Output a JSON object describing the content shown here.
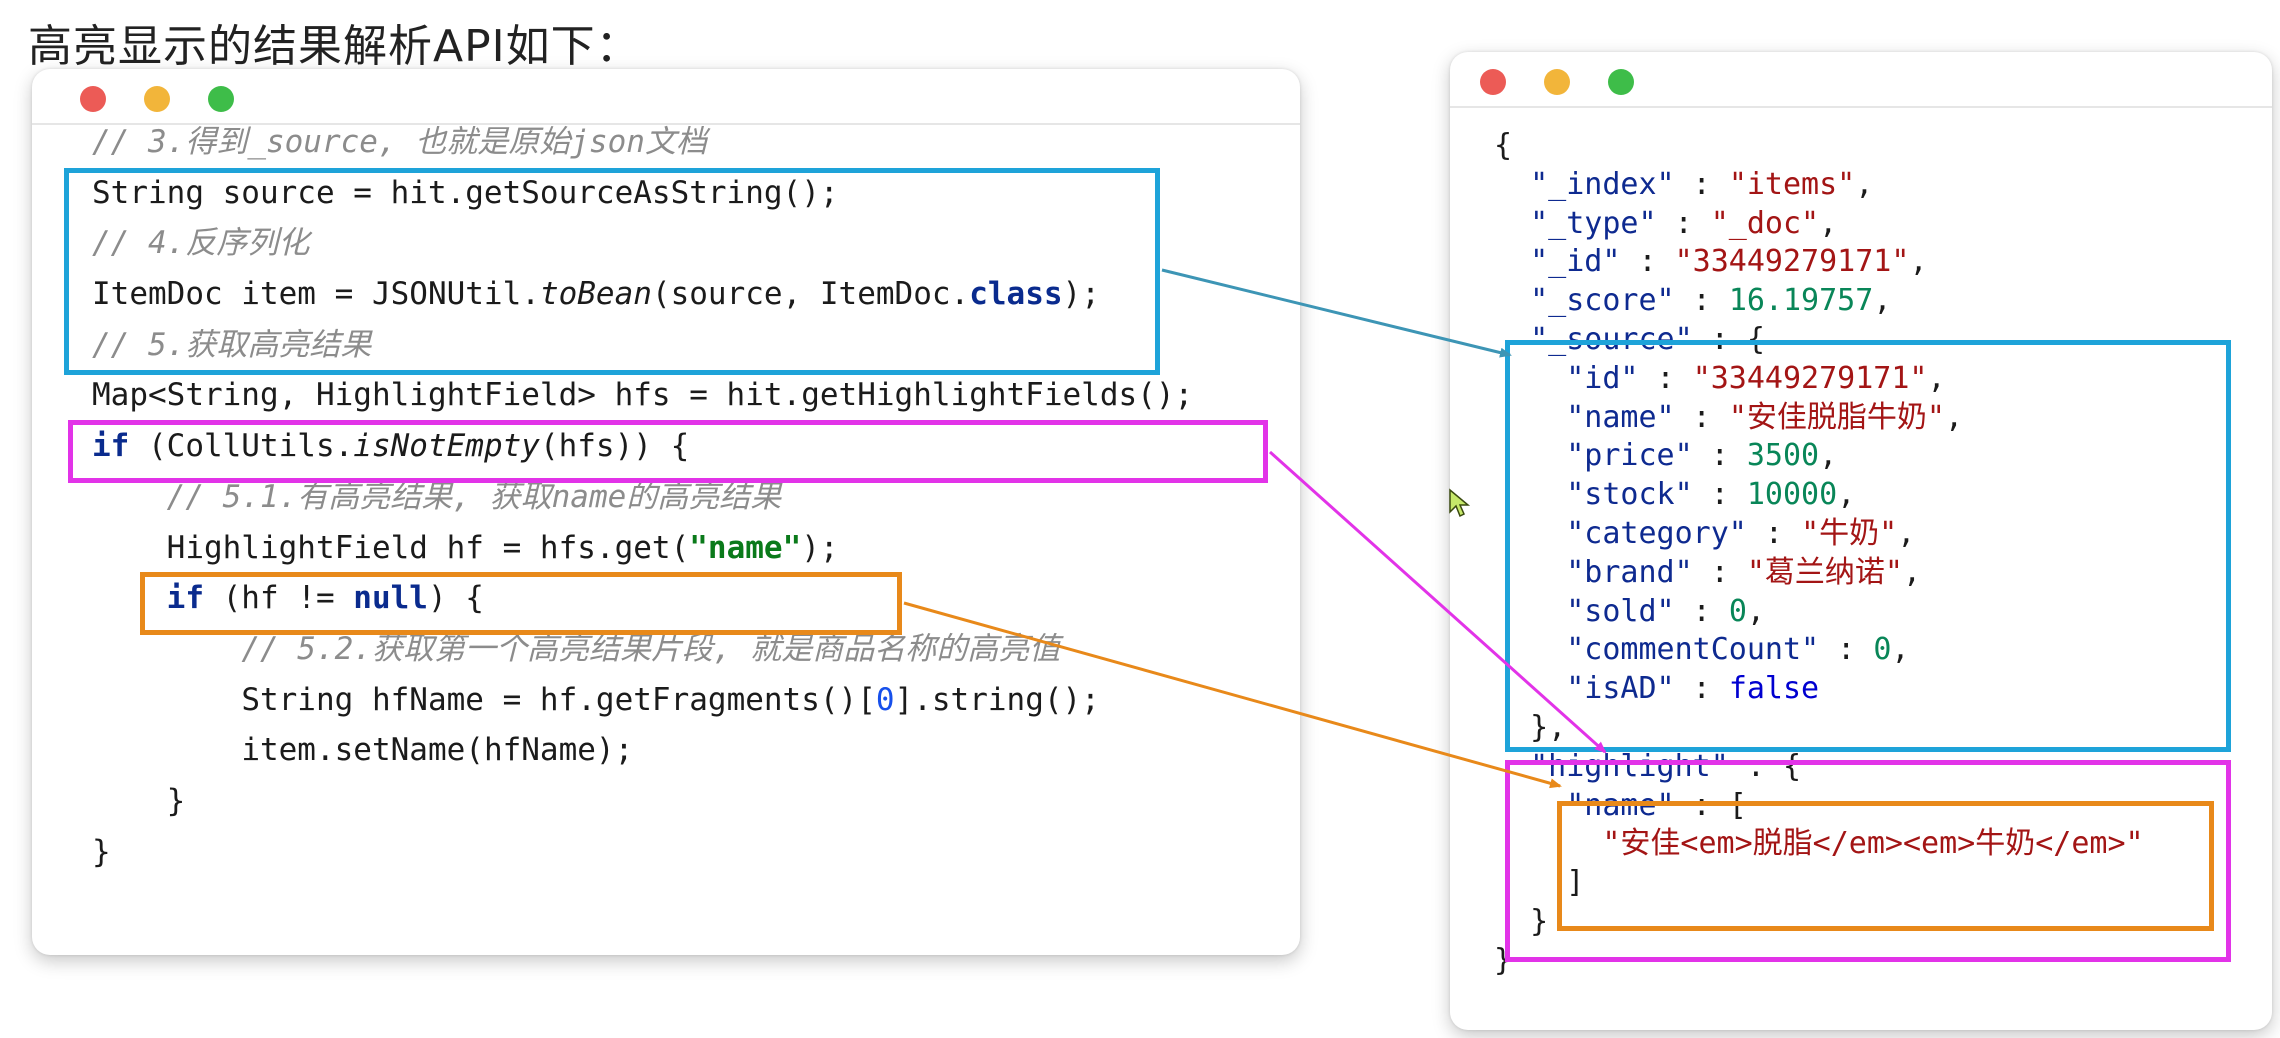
{
  "page": {
    "title": "高亮显示的结果解析API如下："
  },
  "code_window": {
    "lines": [
      {
        "indent": "",
        "parts": [
          {
            "t": "// 3.得到_source, 也就是原始json文档",
            "c": "cm"
          }
        ]
      },
      {
        "indent": "",
        "parts": [
          {
            "t": "String source = hit.getSourceAsString();",
            "c": ""
          }
        ]
      },
      {
        "indent": "",
        "parts": [
          {
            "t": "// 4.反序列化",
            "c": "cm"
          }
        ]
      },
      {
        "indent": "",
        "parts": [
          {
            "t": "ItemDoc item = JSONUtil.",
            "c": ""
          },
          {
            "t": "toBean",
            "c": "it"
          },
          {
            "t": "(source, ItemDoc.",
            "c": ""
          },
          {
            "t": "class",
            "c": "kw"
          },
          {
            "t": ");",
            "c": ""
          }
        ]
      },
      {
        "indent": "",
        "parts": [
          {
            "t": "// 5.获取高亮结果",
            "c": "cm"
          }
        ]
      },
      {
        "indent": "",
        "parts": [
          {
            "t": "Map<String, HighlightField> hfs = hit.getHighlightFields();",
            "c": ""
          }
        ]
      },
      {
        "indent": "",
        "parts": [
          {
            "t": "if",
            "c": "kw"
          },
          {
            "t": " (CollUtils.",
            "c": ""
          },
          {
            "t": "isNotEmpty",
            "c": "it"
          },
          {
            "t": "(hfs)) {",
            "c": ""
          }
        ]
      },
      {
        "indent": "    ",
        "parts": [
          {
            "t": "// 5.1.有高亮结果, 获取name的高亮结果",
            "c": "cm"
          }
        ]
      },
      {
        "indent": "    ",
        "parts": [
          {
            "t": "HighlightField hf = hfs.get(",
            "c": ""
          },
          {
            "t": "\"name\"",
            "c": "str"
          },
          {
            "t": ");",
            "c": ""
          }
        ]
      },
      {
        "indent": "    ",
        "parts": [
          {
            "t": "if",
            "c": "kw"
          },
          {
            "t": " (hf != ",
            "c": ""
          },
          {
            "t": "null",
            "c": "kw"
          },
          {
            "t": ") {",
            "c": ""
          }
        ]
      },
      {
        "indent": "        ",
        "parts": [
          {
            "t": "// 5.2.获取第一个高亮结果片段, 就是商品名称的高亮值",
            "c": "cm"
          }
        ]
      },
      {
        "indent": "        ",
        "parts": [
          {
            "t": "String hfName = hf.getFragments()[",
            "c": ""
          },
          {
            "t": "0",
            "c": "num"
          },
          {
            "t": "].string();",
            "c": ""
          }
        ]
      },
      {
        "indent": "        ",
        "parts": [
          {
            "t": "item.setName(hfName);",
            "c": ""
          }
        ]
      },
      {
        "indent": "    ",
        "parts": [
          {
            "t": "}",
            "c": ""
          }
        ]
      },
      {
        "indent": "",
        "parts": [
          {
            "t": "}",
            "c": ""
          }
        ]
      }
    ]
  },
  "json_window": {
    "lines": [
      {
        "indent": "",
        "parts": [
          {
            "t": "{",
            "c": ""
          }
        ]
      },
      {
        "indent": "  ",
        "parts": [
          {
            "t": "\"_index\"",
            "c": "jkey"
          },
          {
            "t": " : ",
            "c": ""
          },
          {
            "t": "\"items\"",
            "c": "jstr"
          },
          {
            "t": ",",
            "c": ""
          }
        ]
      },
      {
        "indent": "  ",
        "parts": [
          {
            "t": "\"_type\"",
            "c": "jkey"
          },
          {
            "t": " : ",
            "c": ""
          },
          {
            "t": "\"_doc\"",
            "c": "jstr"
          },
          {
            "t": ",",
            "c": ""
          }
        ]
      },
      {
        "indent": "  ",
        "parts": [
          {
            "t": "\"_id\"",
            "c": "jkey"
          },
          {
            "t": " : ",
            "c": ""
          },
          {
            "t": "\"33449279171\"",
            "c": "jstr"
          },
          {
            "t": ",",
            "c": ""
          }
        ]
      },
      {
        "indent": "  ",
        "parts": [
          {
            "t": "\"_score\"",
            "c": "jkey"
          },
          {
            "t": " : ",
            "c": ""
          },
          {
            "t": "16.19757",
            "c": "jnum"
          },
          {
            "t": ",",
            "c": ""
          }
        ]
      },
      {
        "indent": "  ",
        "parts": [
          {
            "t": "\"_source\"",
            "c": "jkey"
          },
          {
            "t": " : {",
            "c": ""
          }
        ]
      },
      {
        "indent": "    ",
        "parts": [
          {
            "t": "\"id\"",
            "c": "jkey"
          },
          {
            "t": " : ",
            "c": ""
          },
          {
            "t": "\"33449279171\"",
            "c": "jstr"
          },
          {
            "t": ",",
            "c": ""
          }
        ]
      },
      {
        "indent": "    ",
        "parts": [
          {
            "t": "\"name\"",
            "c": "jkey"
          },
          {
            "t": " : ",
            "c": ""
          },
          {
            "t": "\"安佳脱脂牛奶\"",
            "c": "jstr"
          },
          {
            "t": ",",
            "c": ""
          }
        ]
      },
      {
        "indent": "    ",
        "parts": [
          {
            "t": "\"price\"",
            "c": "jkey"
          },
          {
            "t": " : ",
            "c": ""
          },
          {
            "t": "3500",
            "c": "jnum"
          },
          {
            "t": ",",
            "c": ""
          }
        ]
      },
      {
        "indent": "    ",
        "parts": [
          {
            "t": "\"stock\"",
            "c": "jkey"
          },
          {
            "t": " : ",
            "c": ""
          },
          {
            "t": "10000",
            "c": "jnum"
          },
          {
            "t": ",",
            "c": ""
          }
        ]
      },
      {
        "indent": "    ",
        "parts": [
          {
            "t": "\"category\"",
            "c": "jkey"
          },
          {
            "t": " : ",
            "c": ""
          },
          {
            "t": "\"牛奶\"",
            "c": "jstr"
          },
          {
            "t": ",",
            "c": ""
          }
        ]
      },
      {
        "indent": "    ",
        "parts": [
          {
            "t": "\"brand\"",
            "c": "jkey"
          },
          {
            "t": " : ",
            "c": ""
          },
          {
            "t": "\"葛兰纳诺\"",
            "c": "jstr"
          },
          {
            "t": ",",
            "c": ""
          }
        ]
      },
      {
        "indent": "    ",
        "parts": [
          {
            "t": "\"sold\"",
            "c": "jkey"
          },
          {
            "t": " : ",
            "c": ""
          },
          {
            "t": "0",
            "c": "jnum"
          },
          {
            "t": ",",
            "c": ""
          }
        ]
      },
      {
        "indent": "    ",
        "parts": [
          {
            "t": "\"commentCount\"",
            "c": "jkey"
          },
          {
            "t": " : ",
            "c": ""
          },
          {
            "t": "0",
            "c": "jnum"
          },
          {
            "t": ",",
            "c": ""
          }
        ]
      },
      {
        "indent": "    ",
        "parts": [
          {
            "t": "\"isAD\"",
            "c": "jkey"
          },
          {
            "t": " : ",
            "c": ""
          },
          {
            "t": "false",
            "c": "jbool"
          }
        ]
      },
      {
        "indent": "  ",
        "parts": [
          {
            "t": "},",
            "c": ""
          }
        ]
      },
      {
        "indent": "  ",
        "parts": [
          {
            "t": "\"highlight\"",
            "c": "jkey"
          },
          {
            "t": " : {",
            "c": ""
          }
        ]
      },
      {
        "indent": "    ",
        "parts": [
          {
            "t": "\"name\"",
            "c": "jkey"
          },
          {
            "t": " : [",
            "c": ""
          }
        ]
      },
      {
        "indent": "      ",
        "parts": [
          {
            "t": "\"安佳<em>脱脂</em><em>牛奶</em>\"",
            "c": "jstr"
          }
        ]
      },
      {
        "indent": "    ",
        "parts": [
          {
            "t": "]",
            "c": ""
          }
        ]
      },
      {
        "indent": "  ",
        "parts": [
          {
            "t": "}",
            "c": ""
          }
        ]
      },
      {
        "indent": "",
        "parts": [
          {
            "t": "}",
            "c": ""
          }
        ]
      }
    ]
  },
  "colors": {
    "source_box": "#1ea3d9",
    "highlight_fields_box": "#e233e8",
    "name_field_box": "#e8891a",
    "window_close": "#ec5b56",
    "window_minimize": "#f2b53a",
    "window_maximize": "#3ebd49"
  },
  "icons": [
    "window-close-icon",
    "window-minimize-icon",
    "window-maximize-icon",
    "mouse-cursor-icon"
  ]
}
